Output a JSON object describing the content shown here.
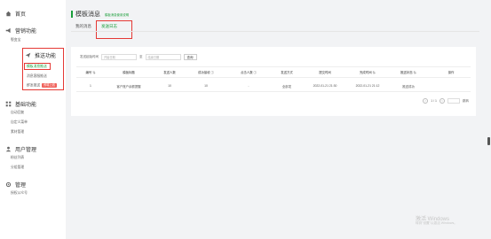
{
  "sidebar": {
    "home": "首页",
    "sections": [
      {
        "title": "营销功能",
        "items": [
          "裂变宝"
        ]
      },
      {
        "title": "推送功能",
        "items": [
          "模板消息推送",
          "消息客服推送",
          "群发推送"
        ],
        "badge": "即将上线"
      },
      {
        "title": "基础功能",
        "items": [
          "自动回复",
          "自定义菜单",
          "素材管理"
        ]
      },
      {
        "title": "用户管理",
        "items": [
          "粉丝列表",
          "分组管理"
        ]
      },
      {
        "title": "管理",
        "items": [
          "授权公众号"
        ]
      }
    ]
  },
  "header": {
    "title": "模板消息",
    "subtitle": "模板消息使用说明",
    "tabs": [
      "我的消息",
      "发送日志"
    ]
  },
  "filter": {
    "label": "发送起始时间",
    "start_placeholder": "开始日期",
    "separator": "至",
    "end_placeholder": "结束日期",
    "search_label": "查询"
  },
  "table": {
    "columns": [
      "编号 ⇅",
      "模板标题",
      "发送人数",
      "成功接收 ⓘ",
      "点击人数 ⓘ",
      "发送方式",
      "提交时间",
      "完成时间 ⇅",
      "推送状态 ⇅",
      "操作"
    ],
    "rows": [
      [
        "1",
        "客户账户余额提醒",
        "10",
        "10",
        "-",
        "全部发",
        "2022-01-21 21:30",
        "2022-01-21 21:12",
        "推送成功",
        ""
      ]
    ]
  },
  "pagination": {
    "prev": "<",
    "page_info": "1 / 1",
    "next": ">",
    "jump_label": "跳转"
  },
  "watermark": {
    "title": "激活 Windows",
    "subtitle": "转到\"设置\"以激活 Windows。"
  }
}
